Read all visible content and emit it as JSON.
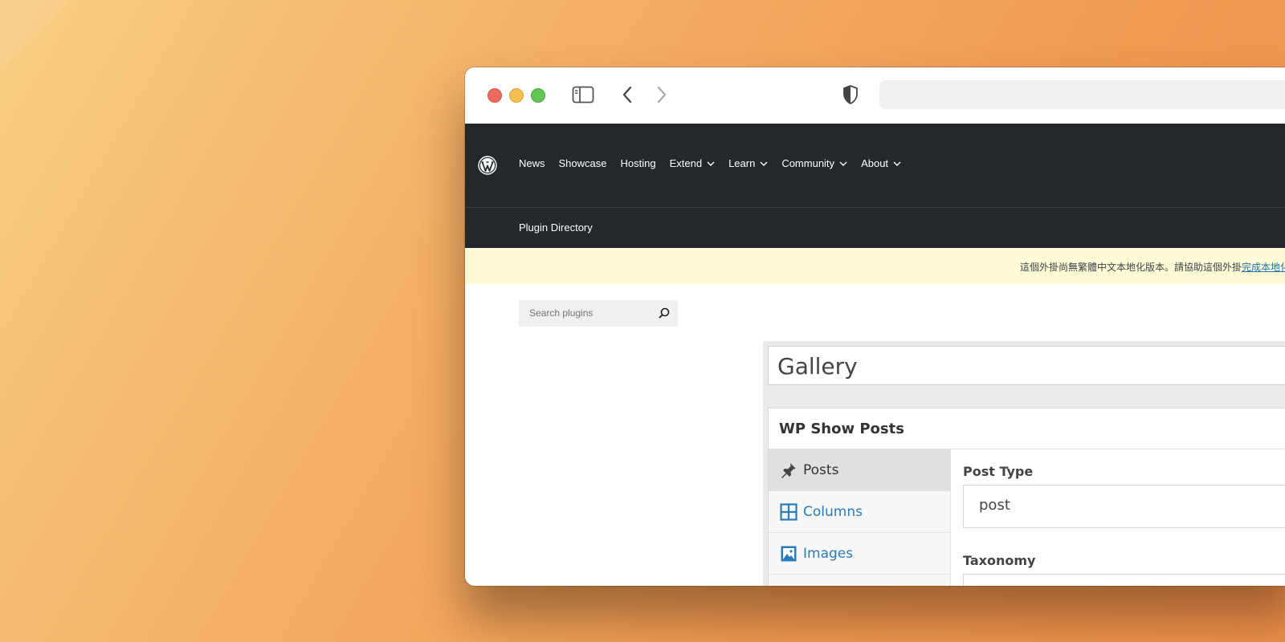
{
  "browser": {
    "icons": [
      "sidebar-toggle-icon",
      "back-arrow-icon",
      "forward-arrow-icon",
      "shield-icon"
    ],
    "url": ""
  },
  "wp_nav": {
    "logo": "wordpress-logo-icon",
    "items": [
      {
        "label": "News",
        "dropdown": false
      },
      {
        "label": "Showcase",
        "dropdown": false
      },
      {
        "label": "Hosting",
        "dropdown": false
      },
      {
        "label": "Extend",
        "dropdown": true
      },
      {
        "label": "Learn",
        "dropdown": true
      },
      {
        "label": "Community",
        "dropdown": true
      },
      {
        "label": "About",
        "dropdown": true
      }
    ],
    "sub_title": "Plugin Directory"
  },
  "notice": {
    "text": "這個外掛尚無繁體中文本地化版本。請協助這個外掛",
    "link": "完成本地化"
  },
  "search": {
    "placeholder": "Search plugins"
  },
  "plugin_screenshot": {
    "title_value": "Gallery",
    "metabox_title": "WP Show Posts",
    "tabs": [
      {
        "label": "Posts",
        "icon": "pushpin-icon",
        "active": true
      },
      {
        "label": "Columns",
        "icon": "columns-grid-icon",
        "active": false
      },
      {
        "label": "Images",
        "icon": "image-icon",
        "active": false
      }
    ],
    "fields": [
      {
        "label": "Post Type",
        "value": "post"
      },
      {
        "label": "Taxonomy",
        "value": ""
      }
    ]
  },
  "colors": {
    "nav_bg": "#23282d",
    "notice_bg": "#fefcd7",
    "link": "#2271b1"
  }
}
